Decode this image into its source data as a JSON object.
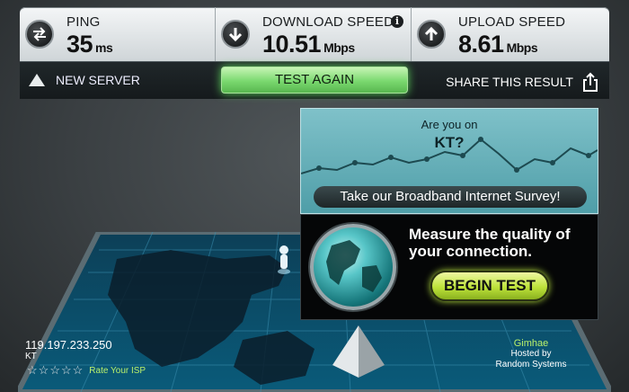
{
  "stats": {
    "ping": {
      "label": "PING",
      "value": "35",
      "unit": "ms"
    },
    "download": {
      "label": "DOWNLOAD SPEED",
      "value": "10.51",
      "unit": "Mbps"
    },
    "upload": {
      "label": "UPLOAD SPEED",
      "value": "8.61",
      "unit": "Mbps"
    }
  },
  "controls": {
    "new_server": "NEW SERVER",
    "test_again": "TEST AGAIN",
    "share": "SHARE THIS RESULT"
  },
  "survey": {
    "question_line1": "Are you on",
    "question_line2": "KT?",
    "button": "Take our Broadband Internet Survey!"
  },
  "ad": {
    "headline_line1": "Measure the quality of",
    "headline_line2": "your connection.",
    "button": "BEGIN TEST"
  },
  "client": {
    "ip": "119.197.233.250",
    "isp": "KT",
    "rating_stars": 5,
    "rate_label": "Rate Your ISP"
  },
  "server": {
    "city": "Gimhae",
    "hosted_line1": "Hosted by",
    "hosted_line2": "Random Systems"
  },
  "colors": {
    "accent_green": "#7ad86f",
    "lime": "#b9f06b",
    "teal": "#4f9ea8"
  }
}
